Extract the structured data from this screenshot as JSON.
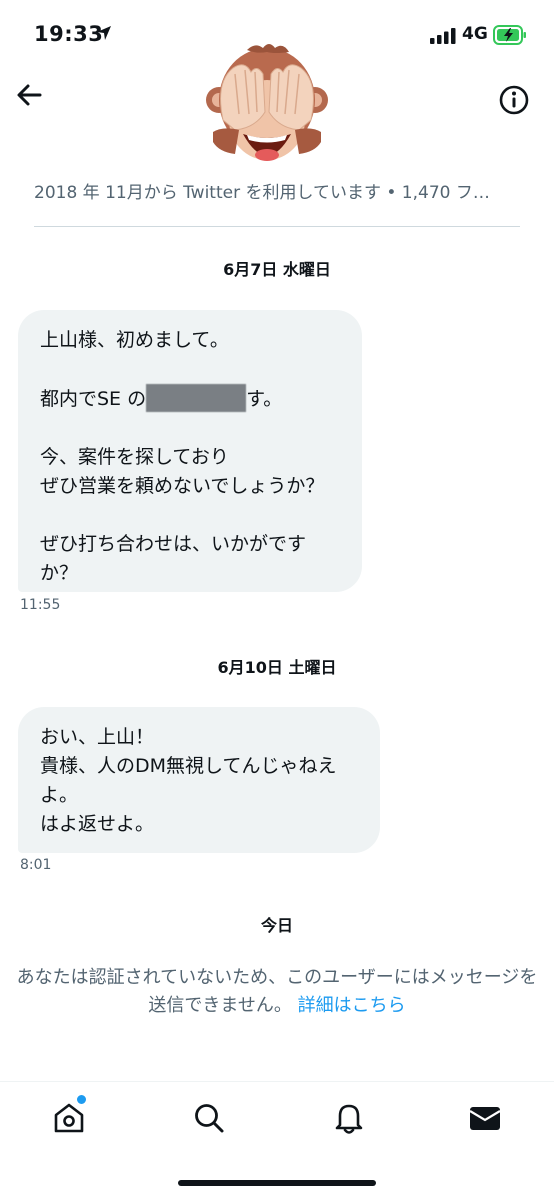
{
  "status_bar": {
    "time": "19:33",
    "network": "4G"
  },
  "header": {
    "profile_line": "2018 年 11月から Twitter を利用しています • 1,470 フ…"
  },
  "conversation": {
    "groups": [
      {
        "date": "6月7日 水曜日",
        "paragraphs": [
          "上山様、初めまして。",
          "都内でSE の",
          "す。",
          "今、案件を探しており\nぜひ営業を頼めないでしょうか？",
          "ぜひ打ち合わせは、いかがです\nか？"
        ],
        "time": "11:55"
      },
      {
        "date": "6月10日 土曜日",
        "text": "おい、上山！\n貴様、人のDM無視してんじゃねえ\nよ。\nはよ返せよ。",
        "time": "8:01"
      }
    ],
    "today_label": "今日",
    "notice_text": "あなたは認証されていないため、このユーザーにはメッセージを送信できません。",
    "notice_link": "詳細はこちら"
  },
  "colors": {
    "accent": "#1d9bf0",
    "bubble": "#eff3f4",
    "muted": "#536471",
    "text": "#0f1419"
  },
  "tabbar": {
    "tabs": [
      {
        "icon": "home-icon",
        "has_notification_dot": true
      },
      {
        "icon": "search-icon"
      },
      {
        "icon": "bell-icon"
      },
      {
        "icon": "mail-icon",
        "active": true
      }
    ]
  }
}
